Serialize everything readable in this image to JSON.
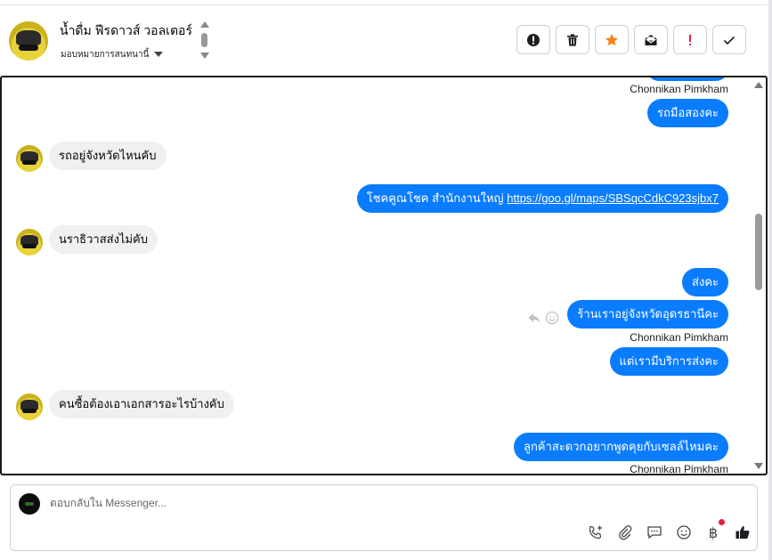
{
  "header": {
    "contact_name": "น้ำดื่ม ฟีรดาวส์ วอลเตอร์",
    "assign_label": "มอบหมายการสนทนานี้",
    "actions": [
      {
        "name": "follow-up-button",
        "icon": "exclamation-circle-icon"
      },
      {
        "name": "delete-button",
        "icon": "trash-icon"
      },
      {
        "name": "star-button",
        "icon": "star-icon"
      },
      {
        "name": "mark-unread-button",
        "icon": "envelope-open-icon"
      },
      {
        "name": "spam-button",
        "icon": "exclamation-icon"
      },
      {
        "name": "mark-done-button",
        "icon": "check-icon"
      }
    ]
  },
  "conversation": {
    "messages": [
      {
        "from": "page",
        "sender": "Chonnikan Pimkham",
        "text": "รถมือสองคะ"
      },
      {
        "from": "customer",
        "text": "รถอยู่จังหวัดไหนคับ"
      },
      {
        "from": "page",
        "text": "โชคคูณโชค สำนักงานใหญ่ ",
        "link": "https://goo.gl/maps/SBSqcCdkC923sjbx7"
      },
      {
        "from": "customer",
        "text": "นราธิวาสส่งไม่คับ"
      },
      {
        "from": "page",
        "text": "ส่งคะ"
      },
      {
        "from": "page",
        "sender": "Chonnikan Pimkham",
        "text": "ร้านเราอยู่จังหวัดอุดรธานีคะ"
      },
      {
        "from": "page",
        "text": "แต่เรามีบริการส่งคะ"
      },
      {
        "from": "customer",
        "text": "คนซื้อต้องเอาเอกสารอะไรบ้างคับ"
      },
      {
        "from": "page",
        "sender": "Chonnikan Pimkham",
        "text": "ลูกค้าสะดวกอยากพูดคุยกับเซลล์ไหมคะ"
      }
    ]
  },
  "composer": {
    "placeholder": "ตอบกลับใน Messenger...",
    "tools": [
      "phone-add-icon",
      "paperclip-icon",
      "saved-reply-icon",
      "emoji-icon",
      "baht-payment-icon",
      "thumbs-up-icon"
    ],
    "baht_symbol": "฿"
  },
  "colors": {
    "outgoing_bubble": "#0a7cff",
    "incoming_bubble": "#f0f0f0",
    "star": "#f5821f",
    "spam": "#e41e3f",
    "notification_dot": "#e41e3f"
  }
}
